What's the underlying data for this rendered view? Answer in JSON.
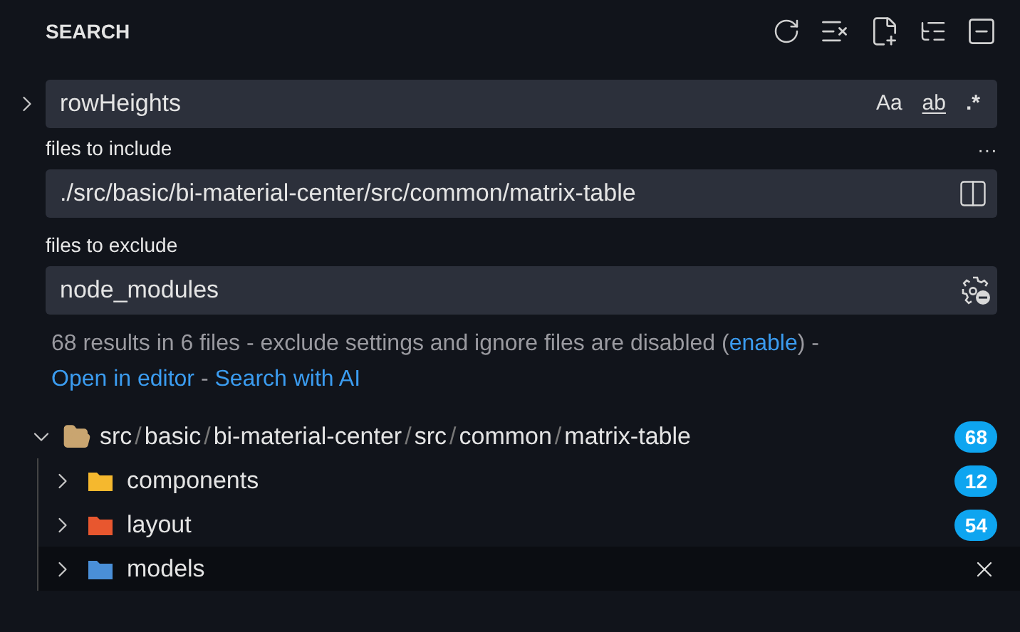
{
  "header": {
    "title": "SEARCH"
  },
  "search": {
    "expanded": false,
    "value": "rowHeights",
    "options": [
      {
        "kind": "case",
        "label": "Aa",
        "on": false
      },
      {
        "kind": "word",
        "label": "ab",
        "on": false
      },
      {
        "kind": "regex",
        "label": ".*",
        "on": false
      }
    ]
  },
  "more": "···",
  "include": {
    "label": "files to include",
    "value": "./src/basic/bi-material-center/src/common/matrix-table"
  },
  "exclude": {
    "label": "files to exclude",
    "value": "node_modules"
  },
  "message": {
    "text": "68 results in 6 files - exclude settings and ignore files are disabled (",
    "link": "enable",
    "after": ") -",
    "open": "Open in editor",
    "sep": " - ",
    "ai": "Search with AI"
  },
  "tree": {
    "expanded": true,
    "segments": [
      "src",
      "basic",
      "bi-material-center",
      "src",
      "common",
      "matrix-table"
    ],
    "separator": "/",
    "count": "68",
    "children": [
      {
        "name": "components",
        "count": "12",
        "color": "#f5b82e",
        "expanded": false,
        "hovered": false
      },
      {
        "name": "layout",
        "count": "54",
        "color": "#e8572f",
        "expanded": false,
        "hovered": false
      },
      {
        "name": "models",
        "color": "#4a8fd8",
        "expanded": false,
        "hovered": true
      }
    ]
  }
}
